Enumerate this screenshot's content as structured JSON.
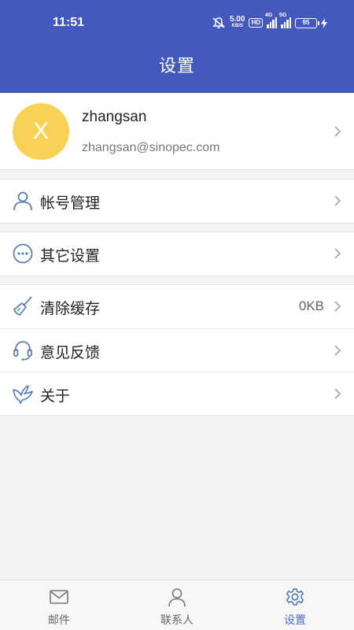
{
  "status_bar": {
    "time": "11:51",
    "net_speed_value": "5.00",
    "net_speed_unit": "KB/S",
    "hd_label": "HD",
    "signal1_label": "4G",
    "signal2_label": "5G",
    "battery": "95"
  },
  "header": {
    "title": "设置"
  },
  "profile": {
    "avatar_letter": "X",
    "avatar_color": "#f8d257",
    "name": "zhangsan",
    "email": "zhangsan@sinopec.com"
  },
  "menu": {
    "account": {
      "label": "帐号管理",
      "icon": "user-icon"
    },
    "other_settings": {
      "label": "其它设置",
      "icon": "more-circle-icon"
    },
    "clear_cache": {
      "label": "清除缓存",
      "value": "0KB",
      "icon": "broom-icon"
    },
    "feedback": {
      "label": "意见反馈",
      "icon": "headset-icon"
    },
    "about": {
      "label": "关于",
      "icon": "bird-icon"
    }
  },
  "tabbar": {
    "tabs": [
      {
        "label": "邮件",
        "icon": "mail-icon",
        "active": false
      },
      {
        "label": "联系人",
        "icon": "contact-icon",
        "active": false
      },
      {
        "label": "设置",
        "icon": "settings-gear-icon",
        "active": true
      }
    ]
  },
  "colors": {
    "header_bg": "#4459bd",
    "accent": "#4a73bf",
    "icon_color": "#5b7fb8"
  }
}
